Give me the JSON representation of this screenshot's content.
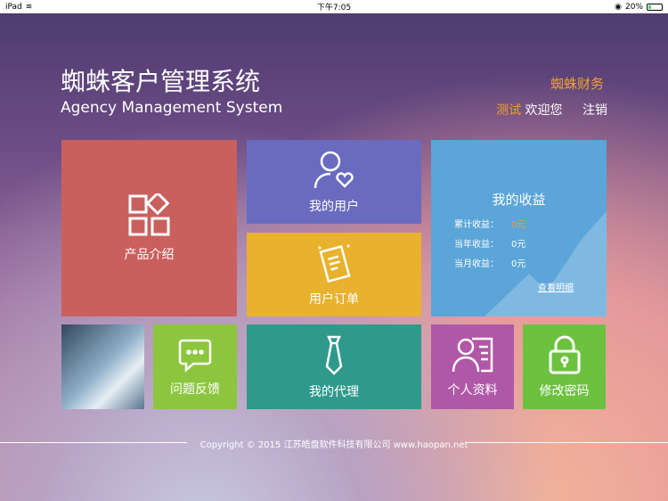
{
  "status_bar": {
    "device": "iPad",
    "time": "下午7:05",
    "battery": "20%"
  },
  "header": {
    "title": "蜘蛛客户管理系统",
    "subtitle": "Agency Management System",
    "brand": "蜘蛛财务",
    "username": "测试",
    "welcome": "欢迎您",
    "logout": "注销"
  },
  "tiles": {
    "product": "产品介绍",
    "my_users": "我的用户",
    "user_orders": "用户订单",
    "feedback": "问题反馈",
    "my_agent": "我的代理",
    "profile": "个人资料",
    "change_password": "修改密码"
  },
  "earnings": {
    "title": "我的收益",
    "rows": [
      {
        "label": "累计收益：",
        "value": "0元"
      },
      {
        "label": "当年收益：",
        "value": "0元"
      },
      {
        "label": "当月收益：",
        "value": "0元"
      }
    ],
    "details_link": "查看明细"
  },
  "footer": {
    "copyright": "Copyright © 2015 江苏皓盘软件科技有限公司 www.haopan.net"
  },
  "colors": {
    "product": "#c9605d",
    "users": "#6a6bbf",
    "orders": "#e8b22e",
    "earnings": "#5ba5d8",
    "feedback": "#8cc63f",
    "agent": "#2f9a8c",
    "profile": "#b058a8",
    "password": "#6cc23f",
    "accent": "#f0a02a"
  }
}
